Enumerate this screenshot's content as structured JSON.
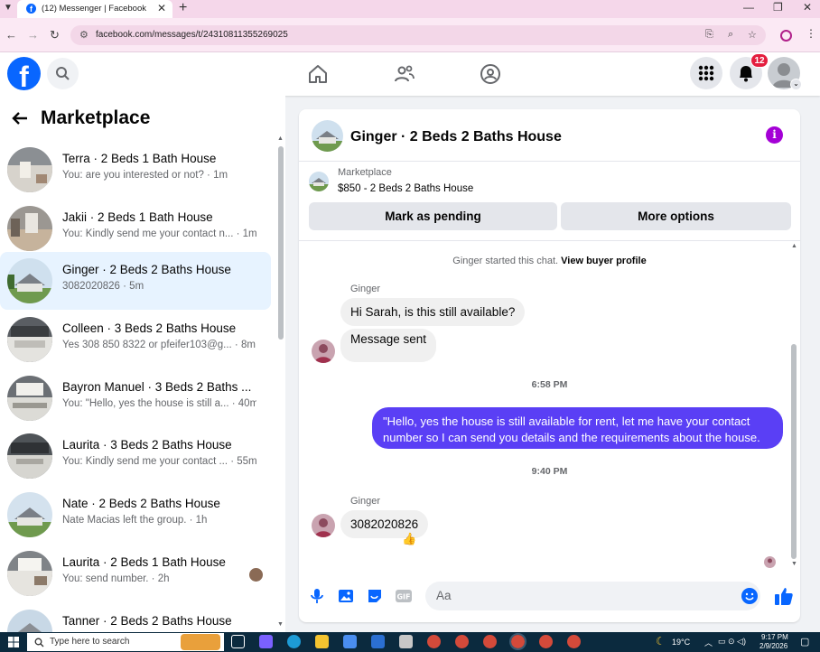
{
  "browser": {
    "tab_title": "(12) Messenger | Facebook",
    "url": "facebook.com/messages/t/24310811355269025"
  },
  "topnav": {
    "notification_count": "12"
  },
  "sidebar": {
    "title": "Marketplace",
    "conversations": [
      {
        "title": "Terra · 2 Beds 1 Bath House",
        "subtitle": "You: are you interested or not? · 1m"
      },
      {
        "title": "Jakii · 2 Beds 1 Bath House",
        "subtitle": "You: Kindly send me your contact n... · 1m"
      },
      {
        "title": "Ginger · 2 Beds 2 Baths House",
        "subtitle": "3082020826 · 5m"
      },
      {
        "title": "Colleen · 3 Beds 2 Baths House",
        "subtitle": "Yes 308 850 8322 or pfeifer103@g... · 8m"
      },
      {
        "title": "Bayron Manuel · 3 Beds 2 Baths ...",
        "subtitle": "You: \"Hello, yes the house is still a... · 40m"
      },
      {
        "title": "Laurita · 3 Beds 2 Baths House",
        "subtitle": "You: Kindly send me your contact ... · 55m"
      },
      {
        "title": "Nate · 2 Beds 2 Baths House",
        "subtitle": "Nate Macias left the group. · 1h"
      },
      {
        "title": "Laurita · 2 Beds 1 Bath House",
        "subtitle": "You: send number. · 2h"
      },
      {
        "title": "Tanner · 2 Beds 2 Baths House",
        "subtitle": ""
      }
    ]
  },
  "chat": {
    "name": "Ginger · 2 Beds 2 Baths House",
    "marketplace_label": "Marketplace",
    "listing": "$850 - 2 Beds 2 Baths House",
    "mark_pending": "Mark as pending",
    "more_options": "More options",
    "started_text": "Ginger started this chat.",
    "view_profile": "View buyer profile",
    "sender_1": "Ginger",
    "msg_1": "Hi Sarah, is this still available?",
    "msg_2": "Message sent",
    "time_1": "6:58 PM",
    "out_msg": "\"Hello, yes the house is still available for rent, let me have your contact number so I can send you details and the requirements about the house.",
    "time_2": "9:40 PM",
    "sender_2": "Ginger",
    "msg_3": "3082020826",
    "reaction": "👍",
    "composer_placeholder": "Aa"
  },
  "taskbar": {
    "search_placeholder": "Type here to search",
    "weather": "19°C",
    "time": "9:17 PM",
    "date": "2/9/2026"
  },
  "colors": {
    "fb_blue": "#0866ff",
    "outgoing_bubble": "#5a3ff5",
    "selected_row": "#e7f3ff",
    "info_purple": "#a400d6"
  }
}
